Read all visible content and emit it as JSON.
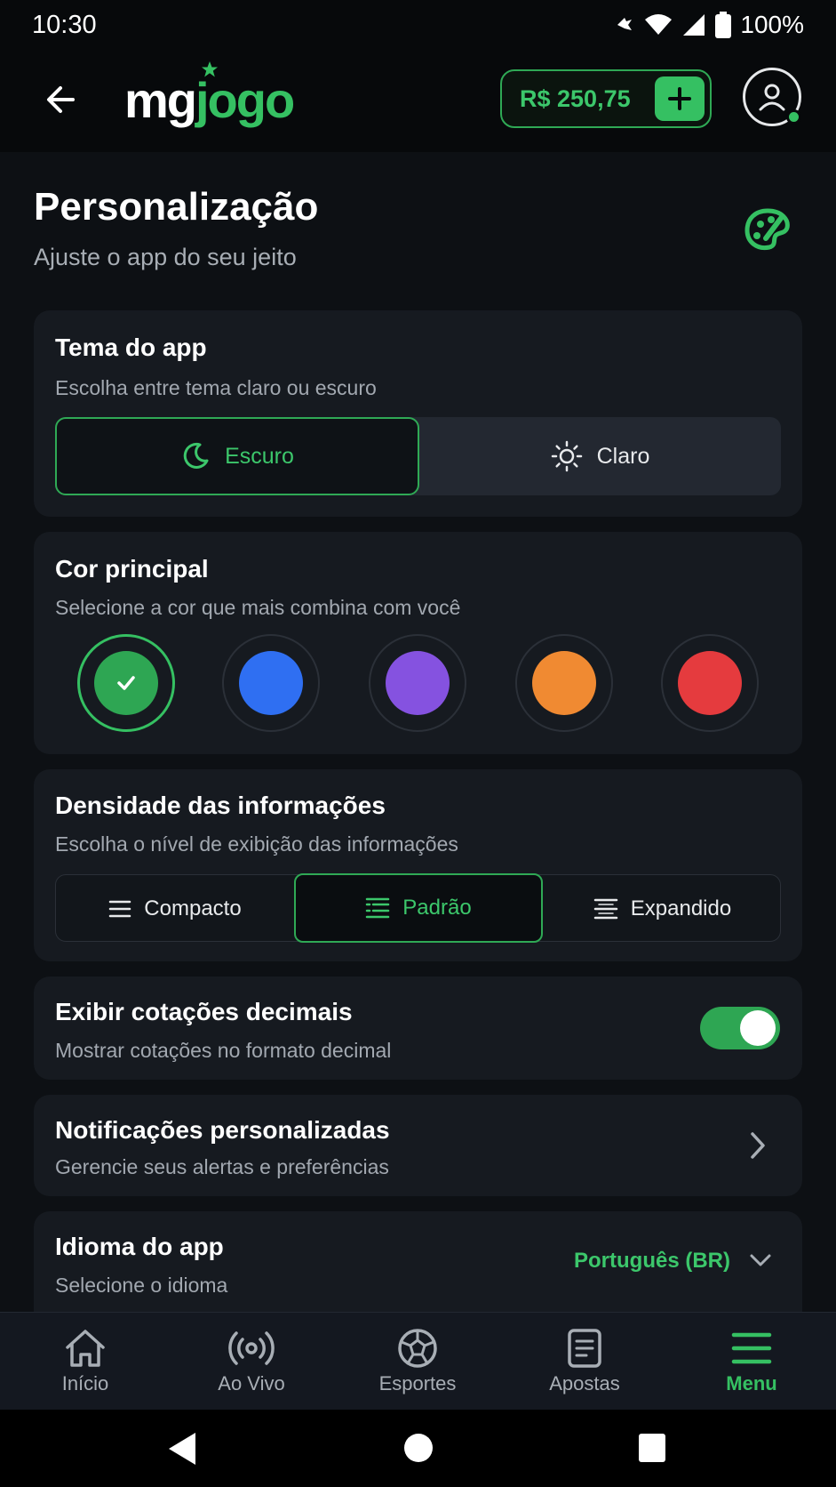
{
  "status_bar": {
    "time": "10:30",
    "battery": "100%"
  },
  "header": {
    "logo_mg": "mg",
    "logo_jogo": "jogo",
    "balance": "R$ 250,75"
  },
  "page": {
    "title": "Personalização",
    "subtitle": "Ajuste o app do seu jeito"
  },
  "theme": {
    "title": "Tema do app",
    "subtitle": "Escolha entre tema claro ou escuro",
    "options": [
      {
        "label": "Escuro",
        "icon": "moon-icon",
        "selected": true
      },
      {
        "label": "Claro",
        "icon": "sun-icon",
        "selected": false
      }
    ]
  },
  "color": {
    "title": "Cor principal",
    "subtitle": "Selecione a cor que mais combina com você",
    "swatches": [
      {
        "name": "green",
        "hex": "#2ea653",
        "selected": true
      },
      {
        "name": "blue",
        "hex": "#2f6ff2",
        "selected": false
      },
      {
        "name": "purple",
        "hex": "#8552e0",
        "selected": false
      },
      {
        "name": "orange",
        "hex": "#f08a32",
        "selected": false
      },
      {
        "name": "red",
        "hex": "#e53b3e",
        "selected": false
      }
    ]
  },
  "density": {
    "title": "Densidade das informações",
    "subtitle": "Escolha o nível de exibição das informações",
    "options": [
      {
        "label": "Compacto",
        "icon": "list-compact-icon",
        "selected": false
      },
      {
        "label": "Padrão",
        "icon": "list-standard-icon",
        "selected": true
      },
      {
        "label": "Expandido",
        "icon": "list-expanded-icon",
        "selected": false
      }
    ]
  },
  "decimal_odds": {
    "title": "Exibir cotações decimais",
    "subtitle": "Mostrar cotações no formato decimal",
    "enabled": true
  },
  "notifications": {
    "title": "Notificações personalizadas",
    "subtitle": "Gerencie seus alertas e preferências"
  },
  "language": {
    "title": "Idioma do app",
    "subtitle": "Selecione o idioma",
    "value": "Português (BR)"
  },
  "bottom_nav": {
    "items": [
      {
        "label": "Início",
        "icon": "home-icon"
      },
      {
        "label": "Ao Vivo",
        "icon": "live-icon"
      },
      {
        "label": "Esportes",
        "icon": "ball-icon"
      },
      {
        "label": "Apostas",
        "icon": "ticket-icon"
      },
      {
        "label": "Menu",
        "icon": "menu-icon",
        "active": true
      }
    ]
  },
  "colors": {
    "accent": "#35c062",
    "background": "#0d1014",
    "card": "#161a20"
  }
}
